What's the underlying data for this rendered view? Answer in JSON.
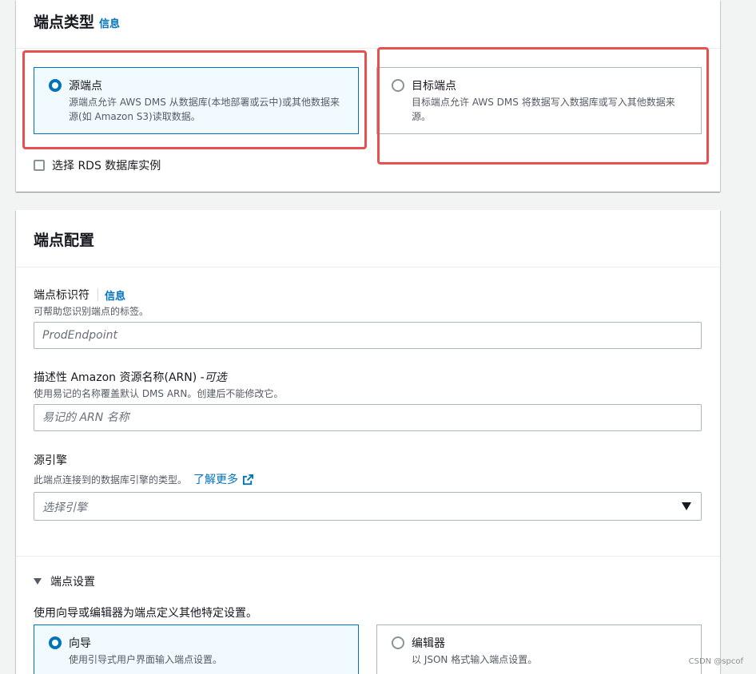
{
  "endpoint_type": {
    "title": "端点类型",
    "info": "信息",
    "source": {
      "label": "源端点",
      "desc": "源端点允许 AWS DMS 从数据库(本地部署或云中)或其他数据来源(如 Amazon S3)读取数据。",
      "selected": true
    },
    "target": {
      "label": "目标端点",
      "desc": "目标端点允许 AWS DMS 将数据写入数据库或写入其他数据来源。",
      "selected": false
    },
    "rds_checkbox": {
      "label": "选择 RDS 数据库实例",
      "checked": false
    }
  },
  "endpoint_config": {
    "title": "端点配置",
    "identifier": {
      "label": "端点标识符",
      "info": "信息",
      "desc": "可帮助您识别端点的标签。",
      "placeholder": "ProdEndpoint"
    },
    "arn": {
      "label": "描述性 Amazon 资源名称(ARN) - ",
      "optional": "可选",
      "desc": "使用易记的名称覆盖默认 DMS ARN。创建后不能修改它。",
      "placeholder": "易记的 ARN 名称"
    },
    "engine": {
      "label": "源引擎",
      "desc": "此端点连接到的数据库引擎的类型。",
      "learn_more": "了解更多",
      "placeholder": "选择引擎"
    },
    "settings": {
      "title": "端点设置",
      "expanded": true,
      "desc": "使用向导或编辑器为端点定义其他特定设置。",
      "wizard": {
        "label": "向导",
        "desc": "使用引导式用户界面输入端点设置。",
        "selected": true
      },
      "editor": {
        "label": "编辑器",
        "desc": "以 JSON 格式输入端点设置。",
        "selected": false
      }
    }
  },
  "watermark": "CSDN @spcof",
  "colors": {
    "accent": "#0073bb",
    "highlight": "#e84f4f",
    "selected_bg": "#f1faff"
  }
}
